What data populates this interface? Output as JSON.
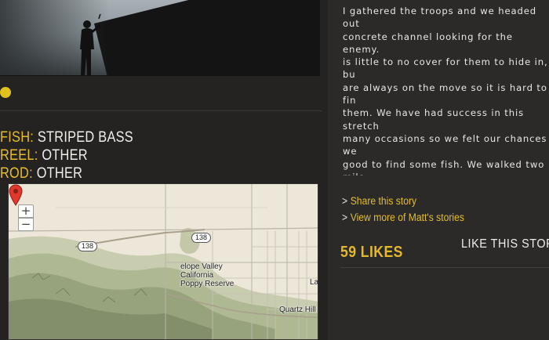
{
  "details": {
    "fish": {
      "label": "FISH:",
      "value": "STRIPED BASS"
    },
    "reel": {
      "label": "REEL:",
      "value": "OTHER"
    },
    "rod": {
      "label": "ROD:",
      "value": "OTHER"
    }
  },
  "map": {
    "zoom_in": "+",
    "zoom_out": "−",
    "route_shield_1": "138",
    "route_shield_2": "138",
    "place_label": "Antelope Valley California Poppy Reserve",
    "place_label_visible": "elope Valley\nCalifornia\nPoppy Reserve",
    "town_label": "Quartz Hill",
    "edge_label": "La"
  },
  "story": {
    "text": "I gathered the troops and we headed out\nconcrete channel looking for the enemy.\nis little to no cover for them to hide in, bu\nare always on the move so it is hard to fin\nthem. We have had success in this stretch\nmany occasions so we felt our chances we\ngood to find some fish. We walked two mile\nand two miles back casting the entire way.\nthrew the complete arsenal at them...jigs,\ncrankbaits and plastics. We each had one s\nbut no hook ups. There were no casualties,\nit is just one of many battles. We will call it a\nreconnaissance mission."
  },
  "actions": {
    "share": "Share this story",
    "view_more": "View more of Matt's stories",
    "likes": "59 LIKES",
    "like_this": "LIKE THIS STORY"
  },
  "colors": {
    "accent": "#e4bd2f",
    "background": "#242322"
  }
}
